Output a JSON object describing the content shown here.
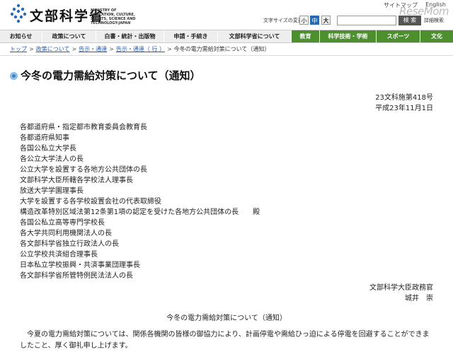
{
  "header": {
    "logo_jp": "文部科学省",
    "logo_en": "MINISTRY OF EDUCATION, CULTURE, SPORTS, SCIENCE AND TECHNOLOGY-JAPAN",
    "sitemap": "サイトマップ",
    "english": "English",
    "watermark": "ReseMom",
    "font_size_label": "文字サイズの変更",
    "font_small": "小",
    "font_mid": "中",
    "font_large": "大",
    "search_placeholder": "",
    "search_button": "検 索",
    "advanced_search": "詳細検索"
  },
  "nav": {
    "items": [
      {
        "label": "お知らせ"
      },
      {
        "label": "政策について"
      },
      {
        "label": "白書・統計・出版物"
      },
      {
        "label": "申請・手続き"
      },
      {
        "label": "文部科学省について"
      },
      {
        "label": "教育"
      },
      {
        "label": "科学技術・学術"
      },
      {
        "label": "スポーツ"
      },
      {
        "label": "文化"
      }
    ]
  },
  "breadcrumb": {
    "items": [
      "トップ",
      "政策について",
      "告示・通達",
      "告示・通達（ 行 ）",
      "今冬の電力需給対策について（通知）"
    ]
  },
  "page": {
    "title": "今冬の電力需給対策について（通知）",
    "doc_number": "23文科施第418号",
    "doc_date": "平成23年11月1日",
    "recipients": [
      "各都道府県・指定都市教育委員会教育長",
      "各都道府県知事",
      "各国公私立大学長",
      "各公立大学法人の長",
      "公立大学を設置する各地方公共団体の長",
      "文部科学大臣所轄各学校法人理事長",
      "放送大学学園理事長",
      "大学を設置する各学校設置会社の代表取締役",
      "構造改革特別区域法第12条第1項の認定を受けた各地方公共団体の長　　殿",
      "各国公私立高等専門学校長",
      "各大学共同利用機関法人の長",
      "各文部科学省独立行政法人の長",
      "公立学校共済組合理事長",
      "日本私立学校振興・共済事業団理事長",
      "各文部科学省所管特例民法法人の長"
    ],
    "sender_org": "文部科学大臣政務官",
    "sender_name": "城井　崇",
    "subject": "今冬の電力需給対策について（通知）",
    "body": "今夏の電力需給対策については、関係各機関の皆様の御協力により、計画停電や需給ひっ迫による停電を回避することができましたこと、厚く御礼申し上げます。"
  },
  "colors": {
    "nav_green": "#4d8f2f",
    "link_blue": "#2a5db0",
    "icon_blue": "#3a86c8"
  }
}
